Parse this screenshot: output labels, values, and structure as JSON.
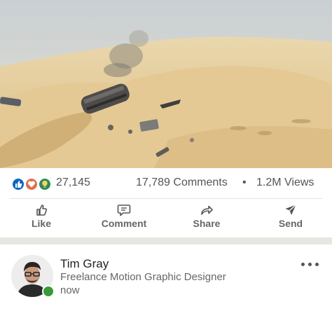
{
  "media": {
    "description_icon": "video-still"
  },
  "stats": {
    "reactions": [
      "like-icon",
      "love-icon",
      "insightful-icon"
    ],
    "reaction_count": "27,145",
    "comments": "17,789 Comments",
    "separator": "•",
    "views": "1.2M Views"
  },
  "actions": {
    "like": "Like",
    "comment": "Comment",
    "share": "Share",
    "send": "Send"
  },
  "post": {
    "author_name": "Tim Gray",
    "author_headline": "Freelance Motion Graphic Designer",
    "timestamp": "now",
    "more_icon": "more-options-icon"
  },
  "colors": {
    "accent_blue": "#0a66c2",
    "love": "#df704d",
    "insightful": "#2e8b57",
    "online": "#3a9a3a"
  }
}
